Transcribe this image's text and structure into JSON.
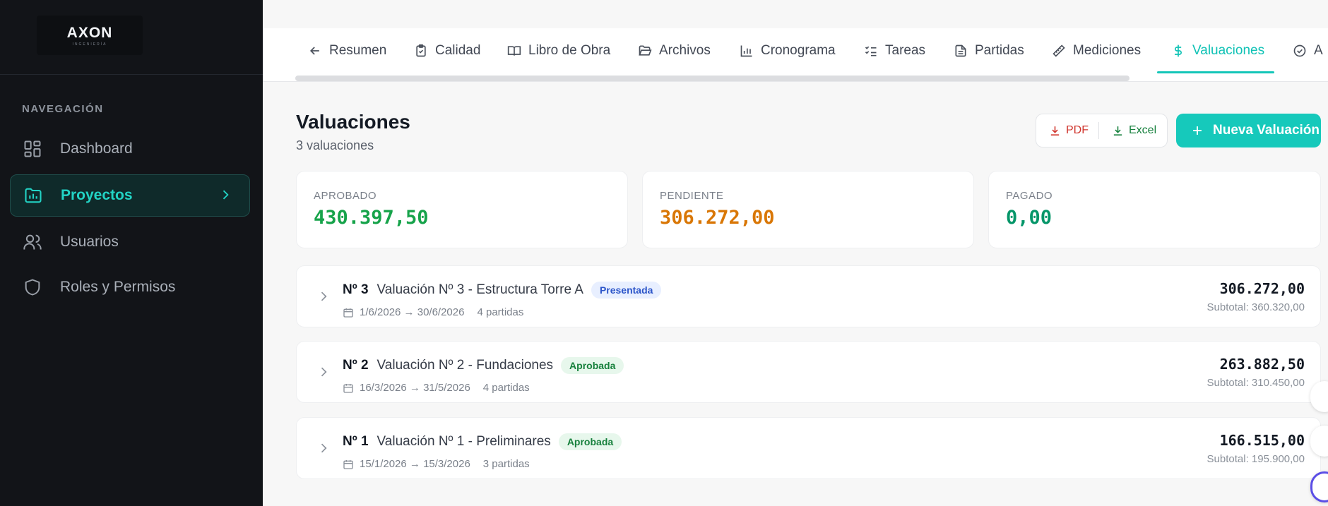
{
  "sidebar": {
    "logo": "AXON",
    "logo_sub": "INGENIERÍA",
    "heading": "NAVEGACIÓN",
    "items": [
      {
        "label": "Dashboard",
        "icon": "dashboard-icon"
      },
      {
        "label": "Proyectos",
        "icon": "folder-chart-icon"
      },
      {
        "label": "Usuarios",
        "icon": "users-icon"
      },
      {
        "label": "Roles y Permisos",
        "icon": "shield-icon"
      }
    ],
    "active_color": "#22d3c5"
  },
  "tabs": [
    {
      "label": "Resumen",
      "icon": "arrow-left-icon"
    },
    {
      "label": "Calidad",
      "icon": "clipboard-check-icon"
    },
    {
      "label": "Libro de Obra",
      "icon": "book-open-icon"
    },
    {
      "label": "Archivos",
      "icon": "folder-open-icon"
    },
    {
      "label": "Cronograma",
      "icon": "bar-chart-icon"
    },
    {
      "label": "Tareas",
      "icon": "list-check-icon"
    },
    {
      "label": "Partidas",
      "icon": "file-text-icon"
    },
    {
      "label": "Mediciones",
      "icon": "ruler-icon"
    },
    {
      "label": "Valuaciones",
      "icon": "dollar-icon"
    },
    {
      "label": "A",
      "icon": "check-circle-icon"
    }
  ],
  "header": {
    "title": "Valuaciones",
    "subtitle": "3 valuaciones",
    "pdf_label": "PDF",
    "excel_label": "Excel",
    "new_label": "Nueva Valuación"
  },
  "stats": [
    {
      "label": "APROBADO",
      "value": "430.397,50",
      "color": "#16a34a"
    },
    {
      "label": "PENDIENTE",
      "value": "306.272,00",
      "color": "#d97706"
    },
    {
      "label": "PAGADO",
      "value": "0,00",
      "color": "#059669"
    }
  ],
  "valuations": [
    {
      "number": "Nº 3",
      "name": "Valuación Nº 3 - Estructura Torre A",
      "status": "Presentada",
      "dates": "1/6/2026 → 30/6/2026",
      "parts": "4 partidas",
      "amount": "306.272,00",
      "subtotal": "Subtotal: 360.320,00"
    },
    {
      "number": "Nº 2",
      "name": "Valuación Nº 2 - Fundaciones",
      "status": "Aprobada",
      "dates": "16/3/2026 → 31/5/2026",
      "parts": "4 partidas",
      "amount": "263.882,50",
      "subtotal": "Subtotal: 310.450,00"
    },
    {
      "number": "Nº 1",
      "name": "Valuación Nº 1 - Preliminares",
      "status": "Aprobada",
      "dates": "15/1/2026 → 15/3/2026",
      "parts": "3 partidas",
      "amount": "166.515,00",
      "subtotal": "Subtotal: 195.900,00"
    }
  ],
  "accent": "#16c9bb"
}
